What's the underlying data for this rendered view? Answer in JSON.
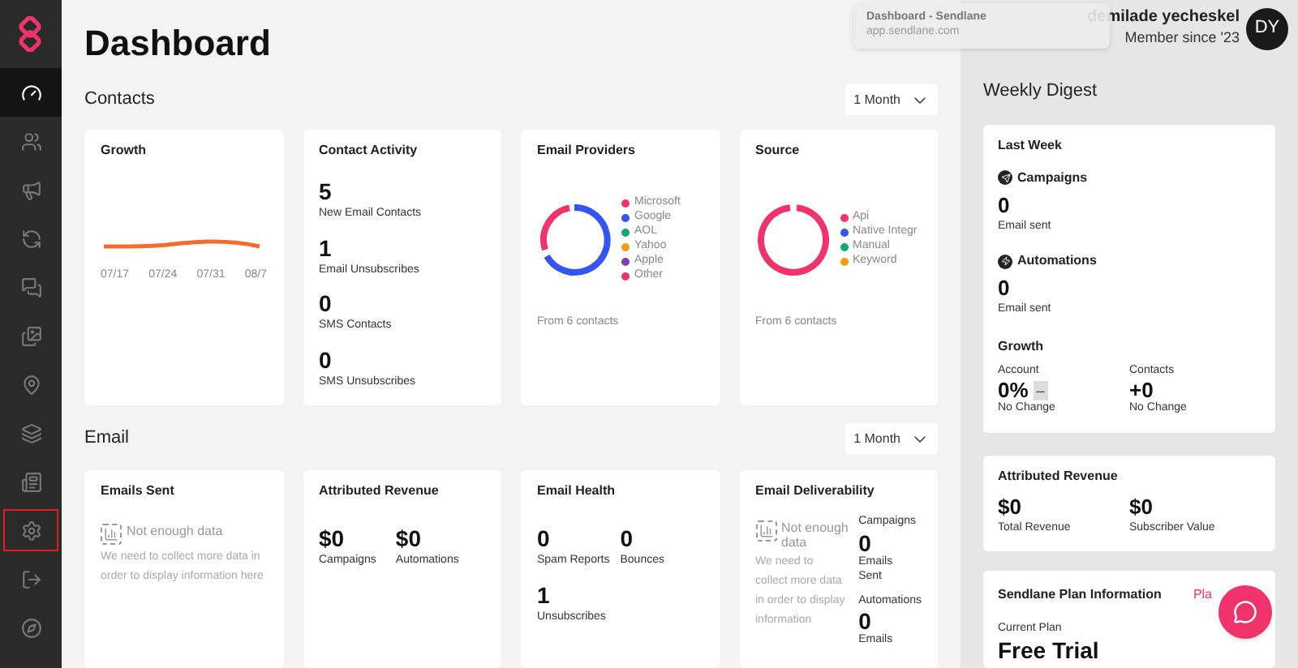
{
  "sidebar": {
    "items": [
      {
        "selected": true,
        "outlined": false
      },
      {
        "selected": false,
        "outlined": false
      },
      {
        "selected": false,
        "outlined": false
      },
      {
        "selected": false,
        "outlined": false
      },
      {
        "selected": false,
        "outlined": false
      },
      {
        "selected": false,
        "outlined": false
      },
      {
        "selected": false,
        "outlined": false
      },
      {
        "selected": false,
        "outlined": false
      },
      {
        "selected": false,
        "outlined": false
      },
      {
        "selected": false,
        "outlined": true
      },
      {
        "selected": false,
        "outlined": false
      },
      {
        "selected": false,
        "outlined": false
      }
    ]
  },
  "title": "Dashboard",
  "tooltip": {
    "title": "Dashboard - Sendlane",
    "url": "app.sendlane.com"
  },
  "user": {
    "name": "demilade yecheskel",
    "since": "Member since '23",
    "initials": "DY"
  },
  "contacts": {
    "heading": "Contacts",
    "period": "1 Month",
    "growth": {
      "title": "Growth",
      "x_labels": [
        "07/17",
        "07/24",
        "07/31",
        "08/7"
      ]
    },
    "activity": {
      "title": "Contact Activity",
      "stats": [
        {
          "value": "5",
          "label": "New Email Contacts"
        },
        {
          "value": "1",
          "label": "Email Unsubscribes"
        },
        {
          "value": "0",
          "label": "SMS Contacts"
        },
        {
          "value": "0",
          "label": "SMS Unsubscribes"
        }
      ]
    },
    "providers": {
      "title": "Email Providers",
      "footer": "From 6 contacts",
      "legend": [
        {
          "label": "Microsoft",
          "color": "#f0336b"
        },
        {
          "label": "Google",
          "color": "#3355f0"
        },
        {
          "label": "AOL",
          "color": "#14a86b"
        },
        {
          "label": "Yahoo",
          "color": "#f59e0b"
        },
        {
          "label": "Apple",
          "color": "#7e3fb8"
        },
        {
          "label": "Other",
          "color": "#f0336b"
        }
      ]
    },
    "source": {
      "title": "Source",
      "footer": "From 6 contacts",
      "legend": [
        {
          "label": "Api",
          "color": "#f0336b"
        },
        {
          "label": "Native Integr",
          "color": "#3355f0"
        },
        {
          "label": "Manual",
          "color": "#14a86b"
        },
        {
          "label": "Keyword",
          "color": "#f59e0b"
        }
      ]
    }
  },
  "email": {
    "heading": "Email",
    "period": "1 Month",
    "sent": {
      "title": "Emails Sent",
      "empty_title": "Not enough data",
      "empty_text": "We need to collect more data in order to display information here"
    },
    "revenue": {
      "title": "Attributed Revenue",
      "stats": [
        {
          "value": "$0",
          "label": "Campaigns"
        },
        {
          "value": "$0",
          "label": "Automations"
        }
      ]
    },
    "health": {
      "title": "Email Health",
      "stats": [
        {
          "value": "0",
          "label": "Spam Reports"
        },
        {
          "value": "0",
          "label": "Bounces"
        },
        {
          "value": "1",
          "label": "Unsubscribes"
        }
      ]
    },
    "deliverability": {
      "title": "Email Deliverability",
      "empty_title": "Not enough data",
      "empty_text": "We need to collect more data in order to display information",
      "stats": [
        {
          "heading": "Campaigns",
          "value": "0",
          "label": "Emails Sent"
        },
        {
          "heading": "Automations",
          "value": "0",
          "label": "Emails"
        }
      ]
    }
  },
  "digest": {
    "heading": "Weekly Digest",
    "last_week": "Last Week",
    "sections": [
      {
        "title": "Campaigns",
        "value": "0",
        "label": "Email sent"
      },
      {
        "title": "Automations",
        "value": "0",
        "label": "Email sent"
      }
    ],
    "growth": {
      "title": "Growth",
      "items": [
        {
          "label": "Account",
          "value": "0%",
          "badge": "–",
          "change": "No Change"
        },
        {
          "label": "Contacts",
          "value": "+0",
          "change": "No Change"
        }
      ]
    },
    "revenue": {
      "title": "Attributed Revenue",
      "stats": [
        {
          "value": "$0",
          "label": "Total Revenue"
        },
        {
          "value": "$0",
          "label": "Subscriber Value"
        }
      ]
    },
    "plan": {
      "title": "Sendlane Plan Information",
      "link": "Pla",
      "current_label": "Current Plan",
      "current": "Free Trial"
    }
  }
}
